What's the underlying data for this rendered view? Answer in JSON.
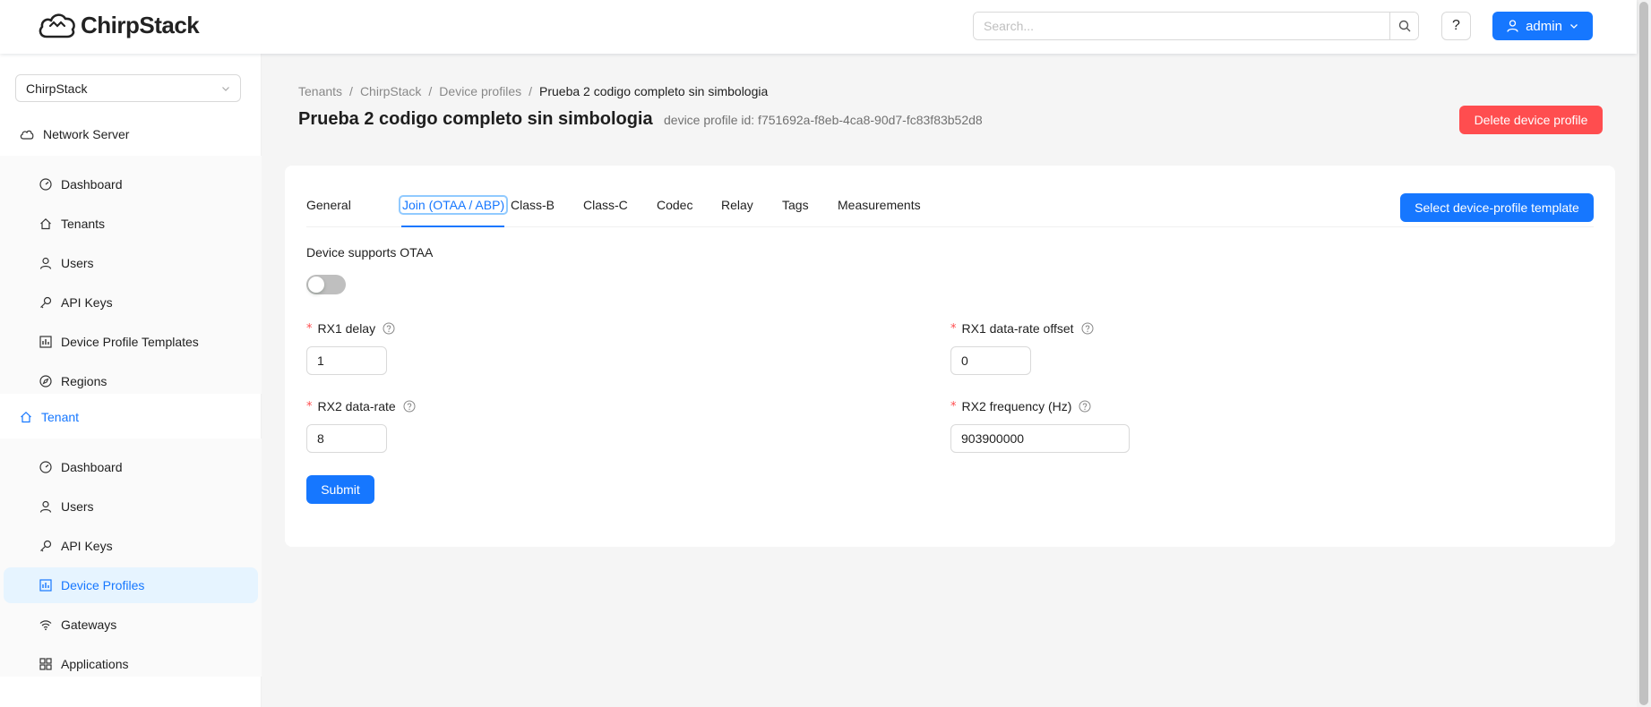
{
  "app": {
    "name": "ChirpStack"
  },
  "header": {
    "search_placeholder": "Search...",
    "help_label": "?",
    "user_label": "admin"
  },
  "sidebar": {
    "tenant_select": "ChirpStack",
    "network_server": {
      "title": "Network Server",
      "items": [
        {
          "label": "Dashboard",
          "icon": "dashboard-icon"
        },
        {
          "label": "Tenants",
          "icon": "home-icon"
        },
        {
          "label": "Users",
          "icon": "user-icon"
        },
        {
          "label": "API Keys",
          "icon": "key-icon"
        },
        {
          "label": "Device Profile Templates",
          "icon": "chart-icon"
        },
        {
          "label": "Regions",
          "icon": "compass-icon"
        }
      ]
    },
    "tenant": {
      "title": "Tenant",
      "items": [
        {
          "label": "Dashboard",
          "icon": "dashboard-icon"
        },
        {
          "label": "Users",
          "icon": "user-icon"
        },
        {
          "label": "API Keys",
          "icon": "key-icon"
        },
        {
          "label": "Device Profiles",
          "icon": "chart-icon",
          "selected": true
        },
        {
          "label": "Gateways",
          "icon": "wifi-icon"
        },
        {
          "label": "Applications",
          "icon": "apps-icon"
        }
      ]
    }
  },
  "breadcrumb": [
    "Tenants",
    "ChirpStack",
    "Device profiles",
    "Prueba 2 codigo completo sin simbologia"
  ],
  "page": {
    "title": "Prueba 2 codigo completo sin simbologia",
    "subtitle": "device profile id: f751692a-f8eb-4ca8-90d7-fc83f83b52d8",
    "delete_label": "Delete device profile"
  },
  "tabs": [
    "General",
    "Join (OTAA / ABP)",
    "Class-B",
    "Class-C",
    "Codec",
    "Relay",
    "Tags",
    "Measurements"
  ],
  "active_tab": "Join (OTAA / ABP)",
  "template_button": "Select device-profile template",
  "form": {
    "otaa_label": "Device supports OTAA",
    "otaa_enabled": false,
    "rx1_delay": {
      "label": "RX1 delay",
      "value": "1"
    },
    "rx1_dr_offset": {
      "label": "RX1 data-rate offset",
      "value": "0"
    },
    "rx2_dr": {
      "label": "RX2 data-rate",
      "value": "8"
    },
    "rx2_freq": {
      "label": "RX2 frequency (Hz)",
      "value": "903900000"
    },
    "submit_label": "Submit",
    "required_mark": "*"
  },
  "colors": {
    "primary": "#1677ff",
    "danger": "#ff4d4f",
    "selected_bg": "#e6f4ff"
  }
}
